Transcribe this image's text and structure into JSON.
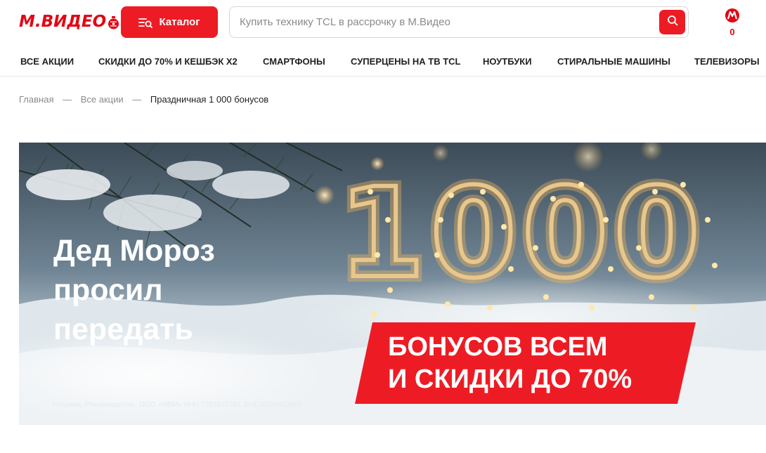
{
  "header": {
    "logo_text": "М.ВИДЕО",
    "catalog_label": "Каталог",
    "search": {
      "placeholder": "Купить технику TCL в рассрочку в М.Видео",
      "value": ""
    },
    "bonus_count": "0",
    "brand_color": "#e30613",
    "icons": {
      "catalog": "catalog-search-icon",
      "search": "search-icon",
      "bonus": "bonus-logo-icon",
      "logo": "christmas-ornament-icon"
    }
  },
  "nav": {
    "items": [
      "ВСЕ АКЦИИ",
      "СКИДКИ ДО 70% И КЕШБЭК X2",
      "СМАРТФОНЫ",
      "СУПЕРЦЕНЫ НА ТВ TCL",
      "НОУТБУКИ",
      "СТИРАЛЬНЫЕ МАШИНЫ",
      "ТЕЛЕВИЗОРЫ"
    ]
  },
  "breadcrumb": {
    "items": [
      "Главная",
      "Все акции"
    ],
    "separator": "—",
    "current": "Праздничная 1 000 бонусов"
  },
  "banner": {
    "headline": "Дед Мороз\nпросил\nпередать",
    "big_number": "1000",
    "promo": "БОНУСОВ ВСЕМ\nИ СКИДКИ ДО 70%",
    "ad_disclaimer": "Реклама. Рекламодатель: ООО «МВМ» ИНН 7707548740. Erid: 2SDnjcLZanc",
    "accent_color": "#ed1c24"
  }
}
